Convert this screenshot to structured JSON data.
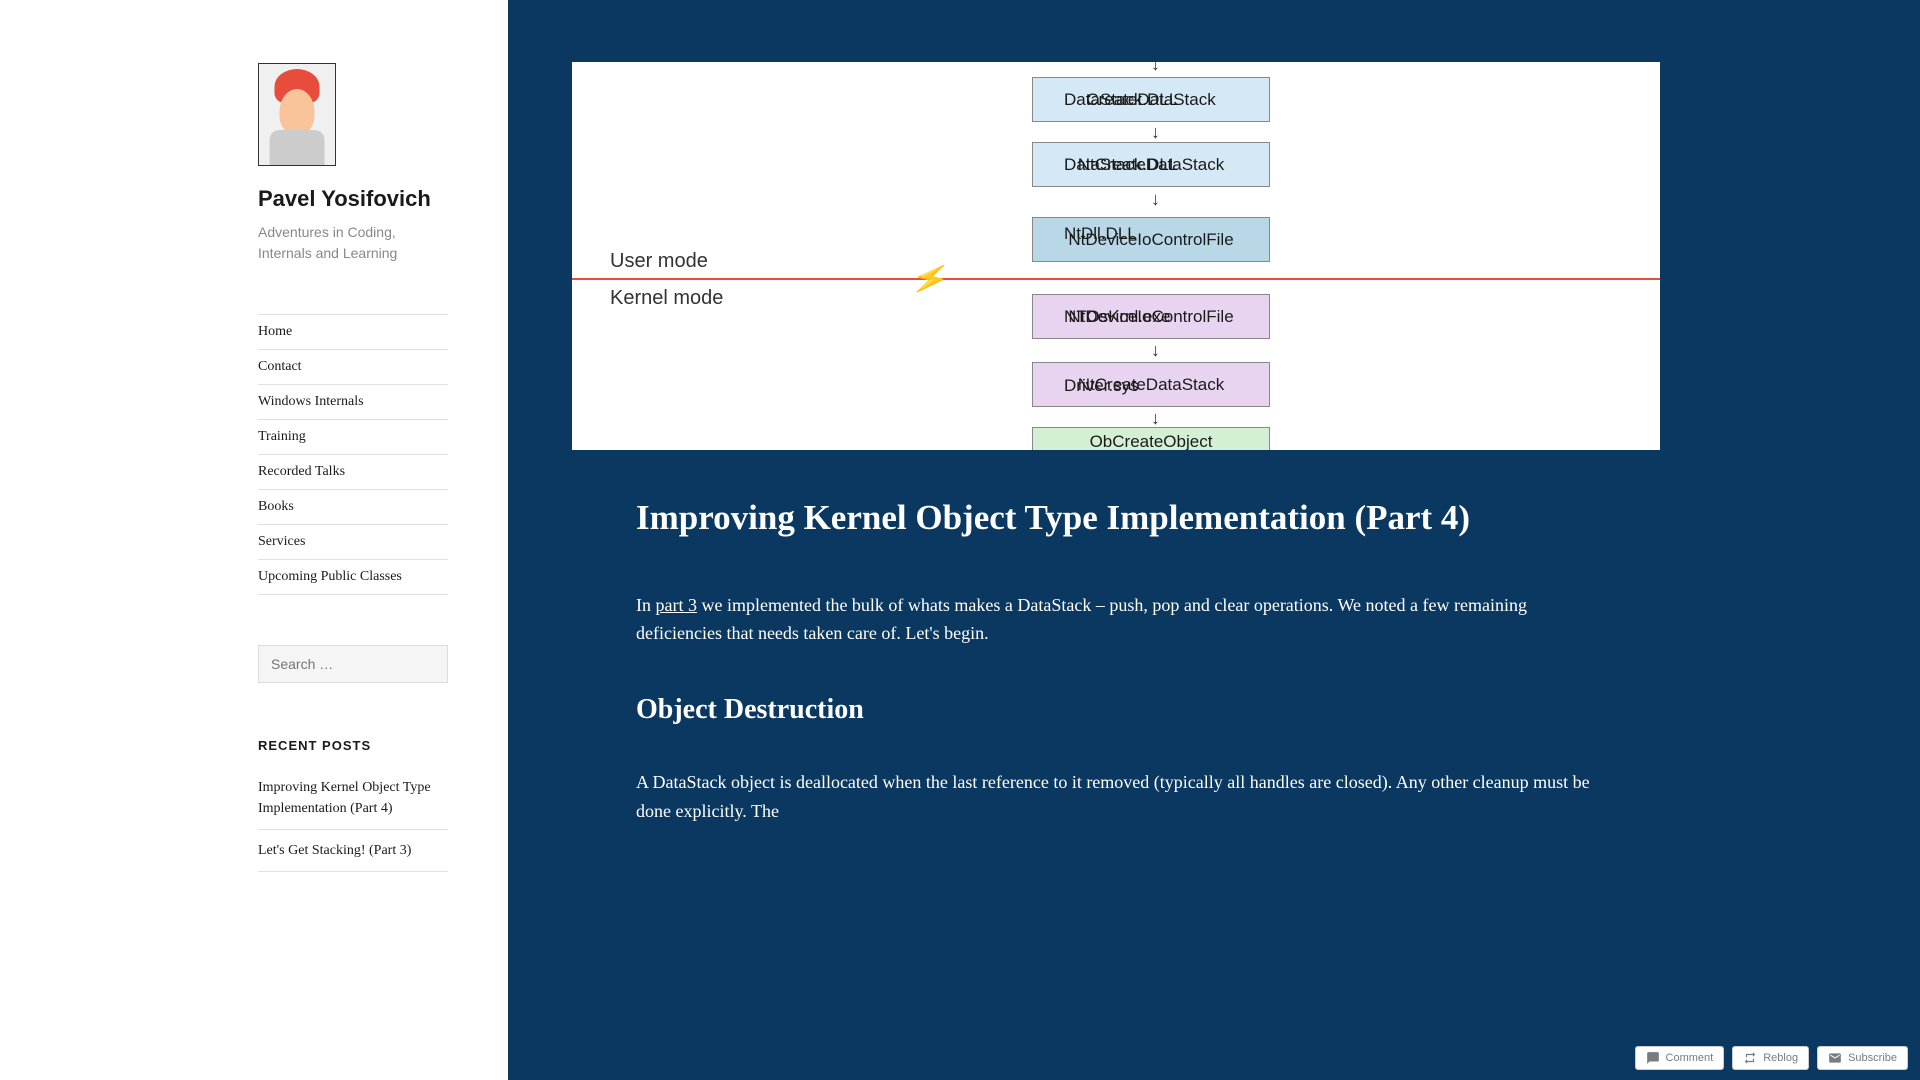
{
  "sidebar": {
    "site_title": "Pavel Yosifovich",
    "tagline": "Adventures in Coding, Internals and Learning",
    "nav": [
      "Home",
      "Contact",
      "Windows Internals",
      "Training",
      "Recorded Talks",
      "Books",
      "Services",
      "Upcoming Public Classes"
    ],
    "search_placeholder": "Search …",
    "recent_title": "RECENT POSTS",
    "recent_posts": [
      "Improving Kernel Object Type Implementation (Part 4)",
      "Let's Get Stacking! (Part 3)"
    ]
  },
  "diagram": {
    "boxes": [
      {
        "text": "CreateDataStack",
        "label": "DataStack.DLL",
        "color": "blue"
      },
      {
        "text": "NtCreateDataStack",
        "label": "DataStack.DLL",
        "color": "blue"
      },
      {
        "text": "NtDeviceIoControlFile",
        "label": "NtDll.DLL",
        "color": "lightblue"
      },
      {
        "text": "NtDeviceIoControlFile",
        "label": "NTOsKrnl.exe",
        "color": "purple"
      },
      {
        "text": "NtCreateDataStack",
        "label": "Driver.sys",
        "color": "purple"
      },
      {
        "text": "ObCreateObject",
        "label": "",
        "color": "green"
      }
    ],
    "user_mode_label": "User mode",
    "kernel_mode_label": "Kernel mode"
  },
  "article": {
    "title": "Improving Kernel Object Type Implementation (Part 4)",
    "intro_prefix": "In ",
    "intro_link": "part 3",
    "intro_suffix": " we implemented the bulk of whats makes a DataStack – push, pop and clear operations. We noted a few remaining deficiencies that needs taken care of. Let's begin.",
    "section_title": "Object Destruction",
    "section_body": "A DataStack object is deallocated when the last reference to it removed (typically all handles are closed). Any other cleanup must be done explicitly. The"
  },
  "footer": {
    "comment": "Comment",
    "reblog": "Reblog",
    "subscribe": "Subscribe"
  }
}
